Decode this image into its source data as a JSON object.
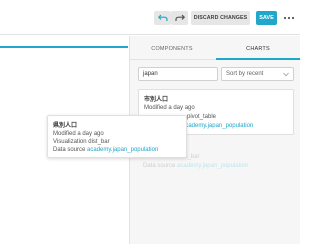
{
  "header": {
    "undo_icon": "undo-icon",
    "redo_icon": "redo-icon",
    "discard_label": "DISCARD CHANGES",
    "save_label": "SAVE",
    "more_icon": "more-options-icon",
    "accent_color": "#20a7c9"
  },
  "panel": {
    "tabs": [
      {
        "label": "COMPONENTS",
        "active": false
      },
      {
        "label": "CHARTS",
        "active": true
      }
    ],
    "search": {
      "value": "japan"
    },
    "sort": {
      "value": "Sort by recent"
    }
  },
  "chart_card": {
    "title": "市別人口",
    "modified": "Modified a day ago",
    "visualization_partial": "pivot_table",
    "datasource_partial": "academy.japan_population"
  },
  "dragged_card": {
    "title": "県別人口",
    "modified": "Modified a day ago",
    "visualization_label": "Visualization",
    "visualization_value": "dist_bar",
    "datasource_label": "Data source",
    "datasource_value": "academy.japan_population"
  },
  "placeholder_card": {
    "visualization_label": "Visualization",
    "visualization_value": "dist_bar",
    "datasource_label": "Data source",
    "datasource_value": "academy.japan_population"
  }
}
